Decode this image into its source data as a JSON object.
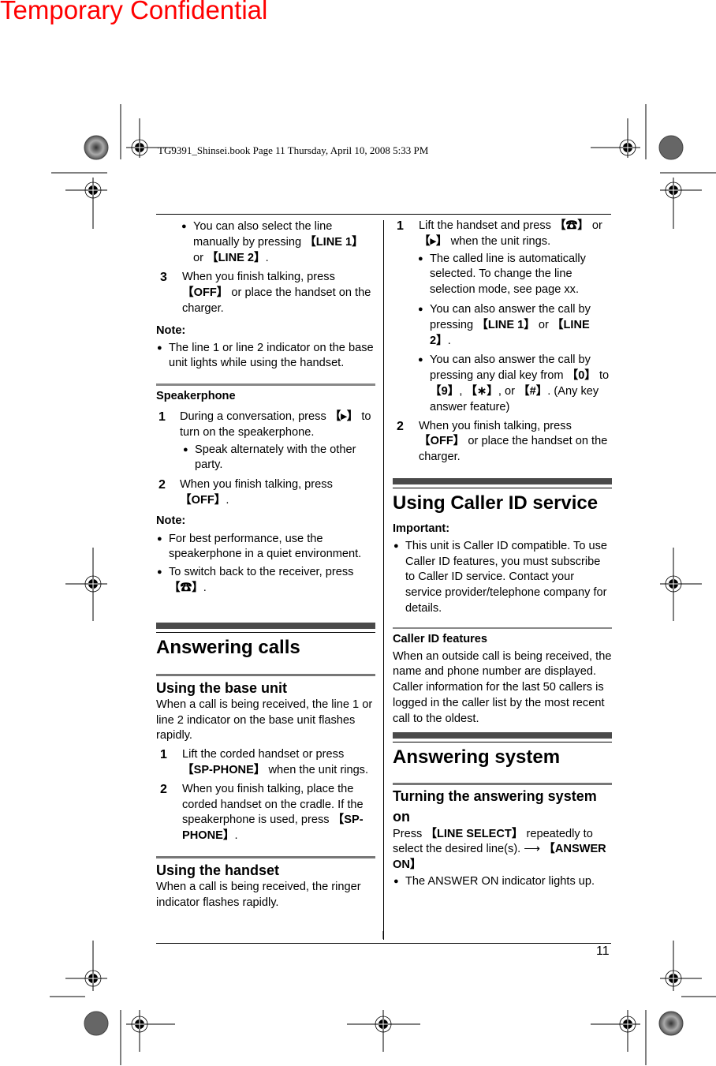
{
  "watermark": "Temporary Confidential",
  "book_header": "TG9391_Shinsei.book  Page 11  Thursday, April 10, 2008  5:33 PM",
  "page_number": "11",
  "left_column": {
    "intro_bullet": {
      "pre": "You can also select the line manually by pressing ",
      "key1": "【LINE 1】",
      "mid": " or ",
      "key2": "【LINE 2】",
      "post": "."
    },
    "step3": {
      "num": "3",
      "pre": "When you finish talking, press ",
      "key": "【OFF】",
      "post": " or place the handset on the charger."
    },
    "note1_title": "Note:",
    "note1_bullet": "The line 1 or line 2 indicator on the base unit lights while using the handset.",
    "speakerphone": {
      "title": "Speakerphone",
      "step1": {
        "num": "1",
        "pre": "During a conversation, press ",
        "key": "【▸】",
        "post": " to turn on the speakerphone."
      },
      "step1_bullet": "Speak alternately with the other party.",
      "step2": {
        "num": "2",
        "pre": "When you finish talking, press ",
        "key": "【OFF】",
        "post": "."
      },
      "note_title": "Note:",
      "note_bullets": [
        "For best performance, use the speakerphone in a quiet environment.",
        {
          "pre": "To switch back to the receiver, press ",
          "key": "【☎】",
          "post": "."
        }
      ]
    },
    "answering_calls": {
      "title": "Answering calls",
      "base_unit": {
        "title": "Using the base unit",
        "intro": "When a call is being received, the line 1 or line 2 indicator on the base unit flashes rapidly.",
        "step1": {
          "num": "1",
          "pre": "Lift the corded handset or press ",
          "key": "【SP-PHONE】",
          "post": " when the unit rings."
        },
        "step2": {
          "num": "2",
          "pre": "When you finish talking, place the corded handset on the cradle. If the speakerphone is used, press ",
          "key": "【SP-PHONE】",
          "post": "."
        }
      },
      "handset": {
        "title": "Using the handset",
        "intro": "When a call is being received, the ringer indicator flashes rapidly."
      }
    }
  },
  "right_column": {
    "step1": {
      "num": "1",
      "pre": "Lift the handset and press ",
      "key1": "【☎】",
      "mid": " or ",
      "key2": "【▸】",
      "post": " when the unit rings."
    },
    "bullets": [
      "The called line is automatically selected. To change the line selection mode, see page xx.",
      {
        "pre": "You can also answer the call by pressing ",
        "key1": "【LINE 1】",
        "mid": " or ",
        "key2": "【LINE 2】",
        "post": "."
      },
      {
        "pre": "You can also answer the call by pressing any dial key from ",
        "key1": "【0】",
        "mid1": " to ",
        "key2": "【9】",
        "mid2": ", ",
        "key3": "【∗】",
        "mid3": ", or ",
        "key4": "【#】",
        "post": ". (Any key answer feature)"
      }
    ],
    "step2": {
      "num": "2",
      "pre": "When you finish talking, press ",
      "key": "【OFF】",
      "post": " or place the handset on the charger."
    },
    "caller_id": {
      "title": "Using Caller ID service",
      "important_title": "Important:",
      "important_bullet": "This unit is Caller ID compatible. To use Caller ID features, you must subscribe to Caller ID service. Contact your service provider/telephone company for details.",
      "features_title": "Caller ID features",
      "features_text1": "When an outside call is being received, the name and phone number are displayed.",
      "features_text2": "Caller information for the last 50 callers is logged in the caller list by the most recent call to the oldest."
    },
    "answering_system": {
      "title": "Answering system",
      "sub_title": "Turning the answering system on",
      "pre": "Press ",
      "key1": "【LINE SELECT】",
      "mid": " repeatedly to select the desired line(s). ⟶ ",
      "key2": "【ANSWER ON】",
      "bullet": "The ANSWER ON indicator lights up."
    }
  }
}
